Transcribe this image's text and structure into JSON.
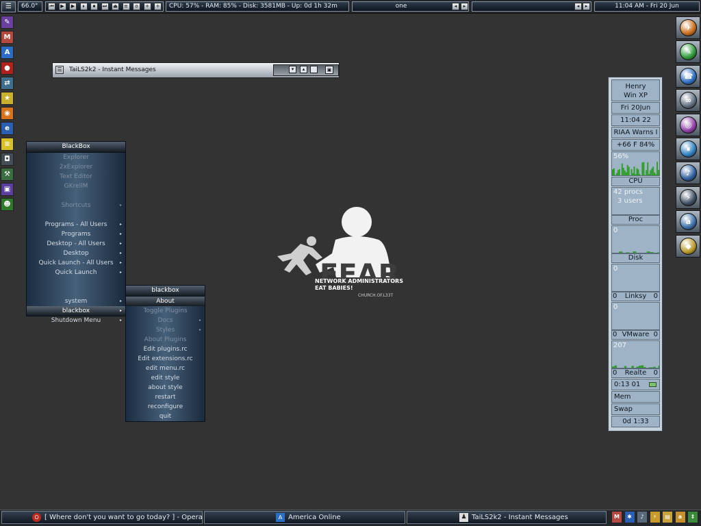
{
  "topbar": {
    "temperature": "66.0°",
    "media_buttons": [
      "⏮",
      "▶",
      "▶",
      "⏸",
      "⏹",
      "⏭",
      "⏏",
      "≡",
      "o",
      "+",
      "+"
    ],
    "system_stats": "CPU: 57% - RAM: 85% - Disk: 3581MB - Up: 0d 1h 32m",
    "workspace": "one",
    "clock": "11:04 AM - Fri 20 Jun"
  },
  "im_window": {
    "title": "TaiLS2k2 - Instant Messages"
  },
  "blackbox_menu": {
    "title": "BlackBox",
    "items": [
      {
        "label": "Explorer",
        "dim": true
      },
      {
        "label": "2xExplorer",
        "dim": true
      },
      {
        "label": "Text Editor",
        "dim": true
      },
      {
        "label": "GKrellM",
        "dim": true
      },
      {
        "label": "",
        "dim": false
      },
      {
        "label": "Shortcuts",
        "dim": true,
        "submenu": true
      },
      {
        "label": "",
        "dim": false
      },
      {
        "label": "Programs - All Users",
        "dim": false,
        "submenu": true
      },
      {
        "label": "Programs",
        "dim": false,
        "submenu": true
      },
      {
        "label": "Desktop - All Users",
        "dim": false,
        "submenu": true
      },
      {
        "label": "Desktop",
        "dim": false,
        "submenu": true
      },
      {
        "label": "Quick Launch - All Users",
        "dim": false,
        "submenu": true
      },
      {
        "label": "Quick Launch",
        "dim": false,
        "submenu": true
      },
      {
        "label": "",
        "dim": false
      },
      {
        "label": "",
        "dim": false
      },
      {
        "label": "system",
        "dim": false,
        "submenu": true
      },
      {
        "label": "blackbox",
        "dim": false,
        "submenu": true,
        "selected": true
      },
      {
        "label": "Shutdown Menu",
        "dim": false,
        "submenu": true
      }
    ]
  },
  "sub_menu": {
    "title": "blackbox",
    "items": [
      {
        "label": "About",
        "selected": true
      },
      {
        "label": "Toggle Plugins",
        "dim": true
      },
      {
        "label": "Docs",
        "dim": true,
        "submenu": true
      },
      {
        "label": "Styles",
        "dim": true,
        "submenu": true
      },
      {
        "label": "About Plugins",
        "dim": true
      },
      {
        "label": "Edit plugins.rc"
      },
      {
        "label": "Edit extensions.rc"
      },
      {
        "label": "edit menu.rc"
      },
      {
        "label": "edit style"
      },
      {
        "label": "about style"
      },
      {
        "label": "restart"
      },
      {
        "label": "reconfigure"
      },
      {
        "label": "quit"
      }
    ]
  },
  "wallpaper": {
    "line1": "NETWORK ADMINISTRATORS",
    "line2": "EAT BABIES!",
    "credit": "CHURCH.OF.L33T"
  },
  "gkrellm": {
    "host": "Henry",
    "os": "Win XP",
    "date": "Fri  20Jun",
    "time": "11:04 22",
    "ticker": "RIAA Warns I",
    "sensors": "+66 F  84%",
    "cpu_pct": "56%",
    "cpu_label": "CPU",
    "procs": "42 procs",
    "users": "3 users",
    "proc_label": "Proc",
    "proc_val": "0",
    "disk_label": "Disk",
    "disk_val": "0",
    "linksys_label": "Linksy",
    "linksys_left": "0",
    "linksys_right": "0",
    "linksys_val": "0",
    "vmware_label": "VMware",
    "vmware_left": "0",
    "vmware_right": "0",
    "vmware_val": "207",
    "realtek_label": "Realte",
    "realtek_left": "0",
    "realtek_right": "0",
    "timer": "0:13 01",
    "mem": "Mem",
    "swap": "Swap",
    "uptime": "0d 1:33"
  },
  "left_icons": [
    {
      "name": "paint-icon",
      "color": "#6a3f9e",
      "glyph": "✎"
    },
    {
      "name": "monitor-icon",
      "color": "#b5483f",
      "glyph": "M"
    },
    {
      "name": "text-editor-icon",
      "color": "#2c6cc4",
      "glyph": "A"
    },
    {
      "name": "record-icon",
      "color": "#b0201c",
      "glyph": "●"
    },
    {
      "name": "network-icon",
      "color": "#3f6e8f",
      "glyph": "⇄"
    },
    {
      "name": "game-icon",
      "color": "#c8b02c",
      "glyph": "★"
    },
    {
      "name": "firefox-icon",
      "color": "#d8731c",
      "glyph": "◉"
    },
    {
      "name": "ie-icon",
      "color": "#2a5fb4",
      "glyph": "e"
    },
    {
      "name": "notes-icon",
      "color": "#d8c02a",
      "glyph": "≡"
    },
    {
      "name": "camera-icon",
      "color": "#444c55",
      "glyph": "◘"
    },
    {
      "name": "tools-icon",
      "color": "#3a6d3f",
      "glyph": "⚒"
    },
    {
      "name": "display-icon",
      "color": "#5a3ea0",
      "glyph": "▣"
    },
    {
      "name": "alien-icon",
      "color": "#2f7a2a",
      "glyph": "☻"
    }
  ],
  "right_dock": [
    {
      "name": "network-neighborhood-icon",
      "color": "#c86d1c",
      "glyph": "✈"
    },
    {
      "name": "paint-tool-icon",
      "color": "#2e9a3a",
      "glyph": "✎"
    },
    {
      "name": "phone-icon",
      "color": "#2f6fc2",
      "glyph": "☎"
    },
    {
      "name": "binoculars-icon",
      "color": "#5f6f7f",
      "glyph": "∞"
    },
    {
      "name": "cd-icon",
      "color": "#8f3fa6",
      "glyph": "◎"
    },
    {
      "name": "pause-icon",
      "color": "#2f7fbf",
      "glyph": "⏸"
    },
    {
      "name": "speaker-icon",
      "color": "#2f5f9f",
      "glyph": "♪"
    },
    {
      "name": "winamp-icon",
      "color": "#3d4f63",
      "glyph": "⚡"
    },
    {
      "name": "aim-icon",
      "color": "#3b6fa8",
      "glyph": "a"
    },
    {
      "name": "folder-icon",
      "color": "#b89a2a",
      "glyph": "◆"
    }
  ],
  "taskbar": [
    {
      "label": "[ Where don't you want to go today? ] - Opera",
      "icon": "opera-icon"
    },
    {
      "label": "America  Online",
      "icon": "aol-icon"
    },
    {
      "label": "TaiLS2k2 - Instant Messages",
      "icon": "aim-person-icon"
    }
  ],
  "tray": [
    {
      "name": "monitor-tray-icon",
      "color": "#b5483f",
      "glyph": "M"
    },
    {
      "name": "bluetooth-tray-icon",
      "color": "#2a5fb4",
      "glyph": "✱"
    },
    {
      "name": "speaker-tray-icon",
      "color": "#5a6a7a",
      "glyph": "♪"
    },
    {
      "name": "lightning-tray-icon",
      "color": "#c89a2a",
      "glyph": "⚡"
    },
    {
      "name": "folder-tray-icon",
      "color": "#c8a33a",
      "glyph": "▤"
    },
    {
      "name": "aim-tray-icon",
      "color": "#c8902a",
      "glyph": "a"
    },
    {
      "name": "updown-tray-icon",
      "color": "#3a8a3a",
      "glyph": "⇕"
    }
  ]
}
